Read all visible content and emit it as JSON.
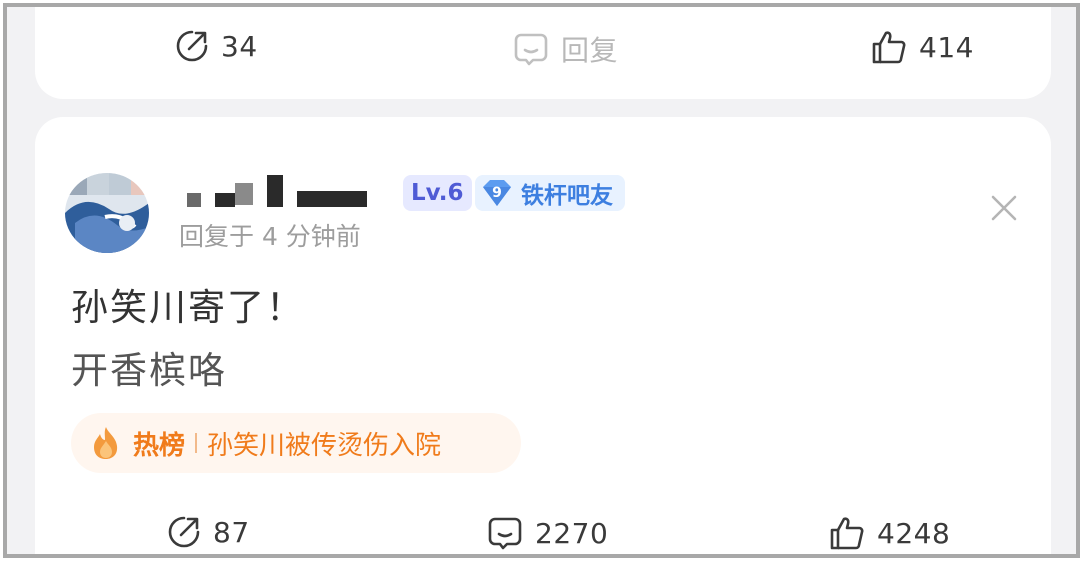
{
  "top_post": {
    "actions": {
      "share_count": "34",
      "reply_label": "回复",
      "like_count": "414"
    }
  },
  "comment": {
    "level": "Lv.6",
    "title_level": "9",
    "title": "铁杆吧友",
    "time": "回复于 4 分钟前",
    "lines": [
      "孙笑川寄了！",
      "开香槟咯"
    ],
    "hot_tag": {
      "label": "热榜",
      "title": "孙笑川被传烫伤入院"
    },
    "actions": {
      "share_count": "87",
      "reply_count": "2270",
      "like_count": "4248"
    }
  },
  "icons": {
    "share": "share-icon",
    "reply": "comment-icon",
    "like": "thumbs-up-icon",
    "close": "close-icon",
    "hot": "flame-icon",
    "title_badge": "gem-icon"
  },
  "colors": {
    "accent_orange": "#f07b1b",
    "level_badge": "#4f5bd5",
    "title_badge": "#3d7fe0",
    "muted": "#b8b8b8"
  }
}
